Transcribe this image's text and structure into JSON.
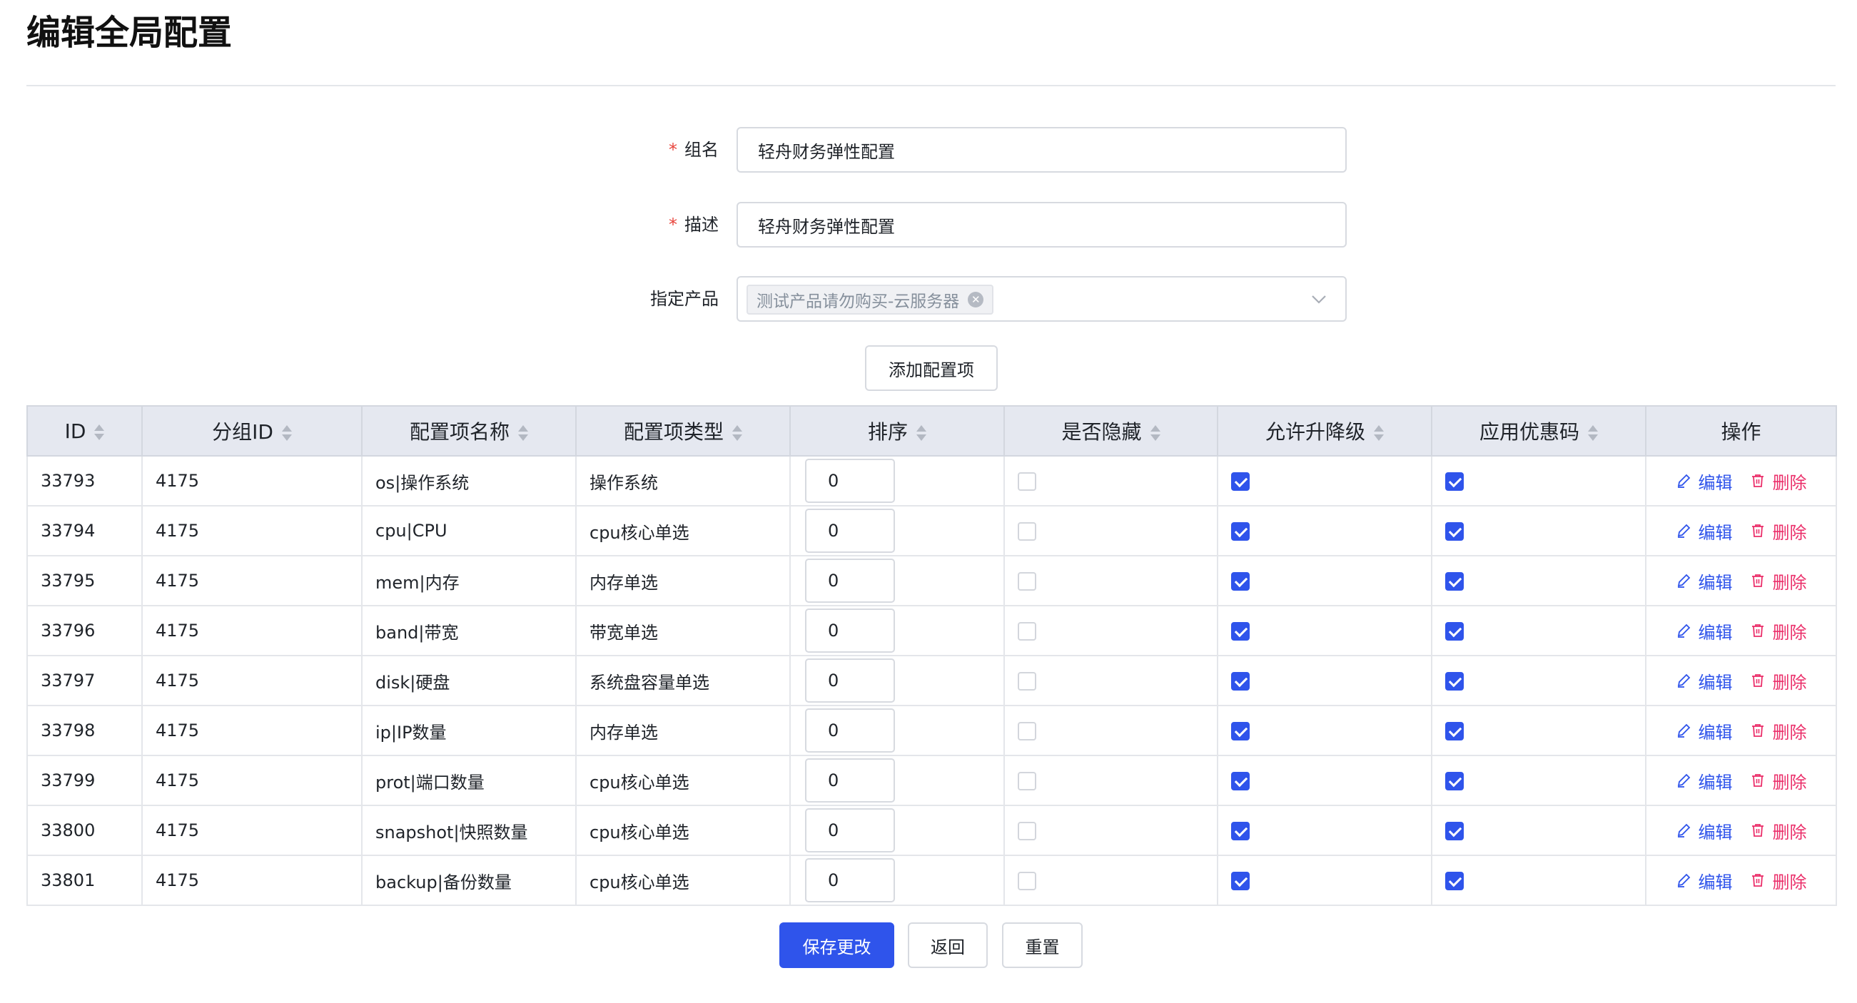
{
  "page": {
    "title": "编辑全局配置"
  },
  "form": {
    "group_name": {
      "label": "组名",
      "required": "*",
      "value": "轻舟财务弹性配置"
    },
    "description": {
      "label": "描述",
      "required": "*",
      "value": "轻舟财务弹性配置"
    },
    "product": {
      "label": "指定产品",
      "tag": "测试产品请勿购买-云服务器"
    },
    "add_item_label": "添加配置项"
  },
  "table": {
    "columns": [
      "ID",
      "分组ID",
      "配置项名称",
      "配置项类型",
      "排序",
      "是否隐藏",
      "允许升降级",
      "应用优惠码",
      "操作"
    ],
    "edit_label": "编辑",
    "delete_label": "删除",
    "rows": [
      {
        "id": "33793",
        "group_id": "4175",
        "name": "os|操作系统",
        "type": "操作系统",
        "order": "0",
        "hidden": false,
        "upgrade": true,
        "coupon": true
      },
      {
        "id": "33794",
        "group_id": "4175",
        "name": "cpu|CPU",
        "type": "cpu核心单选",
        "order": "0",
        "hidden": false,
        "upgrade": true,
        "coupon": true
      },
      {
        "id": "33795",
        "group_id": "4175",
        "name": "mem|内存",
        "type": "内存单选",
        "order": "0",
        "hidden": false,
        "upgrade": true,
        "coupon": true
      },
      {
        "id": "33796",
        "group_id": "4175",
        "name": "band|带宽",
        "type": "带宽单选",
        "order": "0",
        "hidden": false,
        "upgrade": true,
        "coupon": true
      },
      {
        "id": "33797",
        "group_id": "4175",
        "name": "disk|硬盘",
        "type": "系统盘容量单选",
        "order": "0",
        "hidden": false,
        "upgrade": true,
        "coupon": true
      },
      {
        "id": "33798",
        "group_id": "4175",
        "name": "ip|IP数量",
        "type": "内存单选",
        "order": "0",
        "hidden": false,
        "upgrade": true,
        "coupon": true
      },
      {
        "id": "33799",
        "group_id": "4175",
        "name": "prot|端口数量",
        "type": "cpu核心单选",
        "order": "0",
        "hidden": false,
        "upgrade": true,
        "coupon": true
      },
      {
        "id": "33800",
        "group_id": "4175",
        "name": "snapshot|快照数量",
        "type": "cpu核心单选",
        "order": "0",
        "hidden": false,
        "upgrade": true,
        "coupon": true
      },
      {
        "id": "33801",
        "group_id": "4175",
        "name": "backup|备份数量",
        "type": "cpu核心单选",
        "order": "0",
        "hidden": false,
        "upgrade": true,
        "coupon": true
      }
    ]
  },
  "footer": {
    "save_label": "保存更改",
    "back_label": "返回",
    "reset_label": "重置"
  },
  "colors": {
    "primary": "#2f54eb",
    "danger": "#eb2f6a",
    "header_bg": "#e5e8f0"
  }
}
